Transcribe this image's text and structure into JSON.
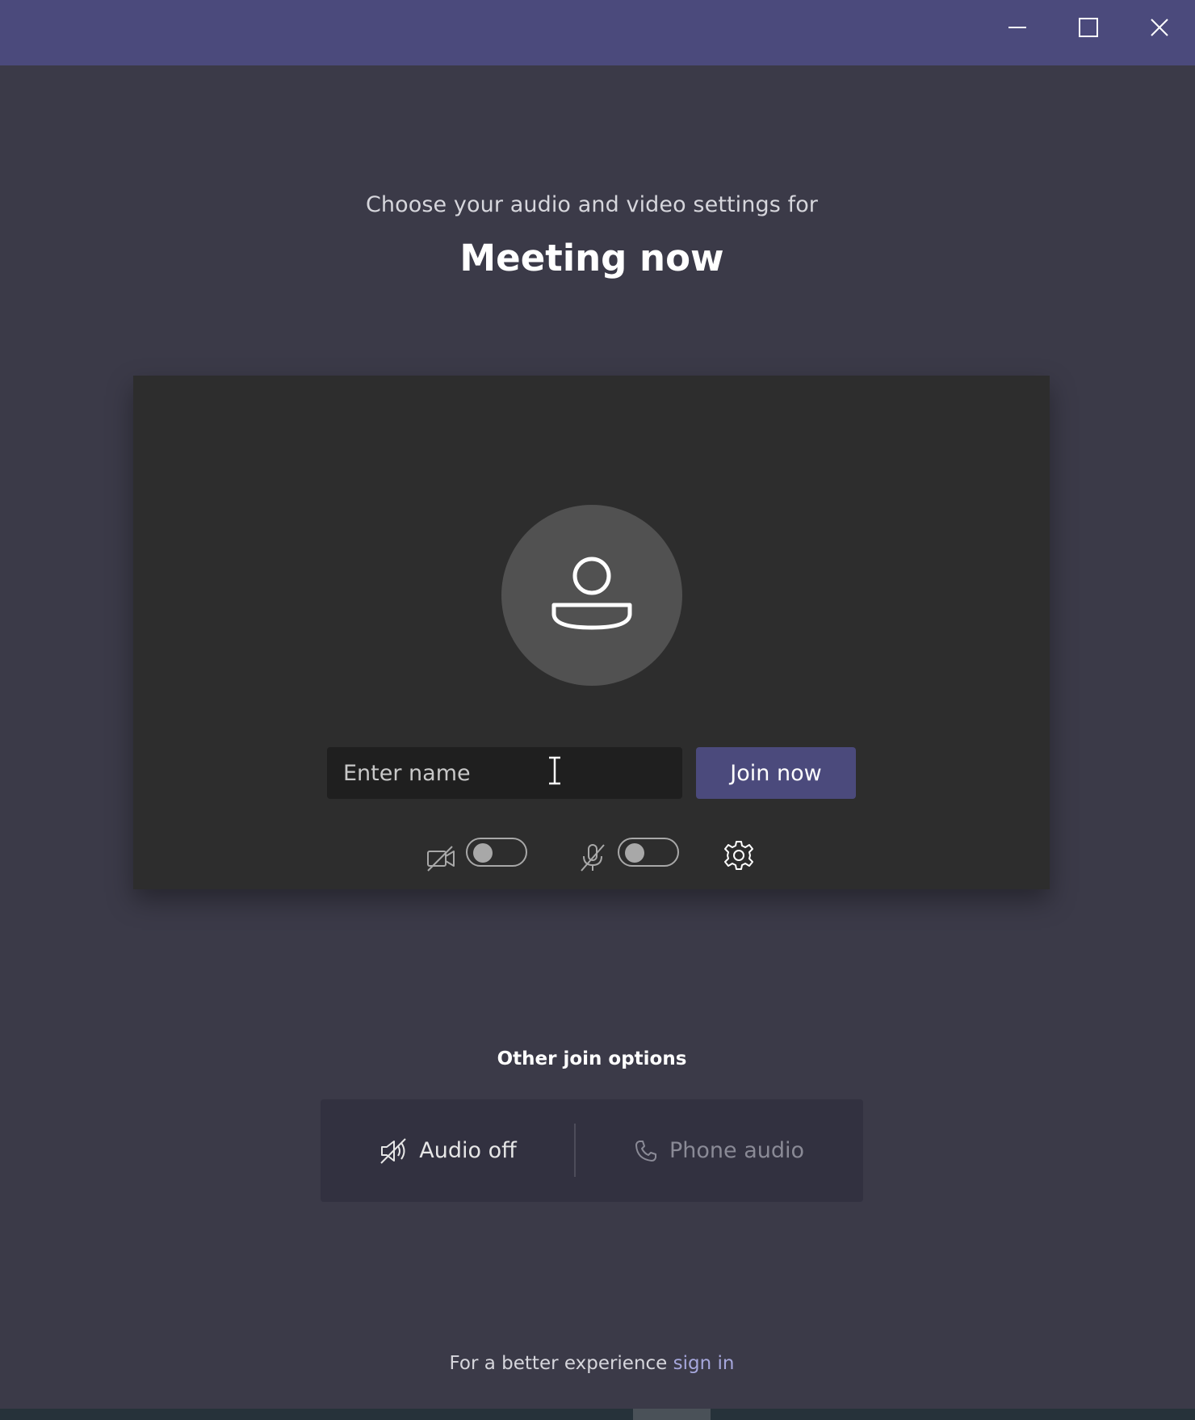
{
  "window": {
    "controls": [
      "minimize",
      "maximize",
      "close"
    ],
    "titlebar_color": "#4b4a7c"
  },
  "header": {
    "subtitle": "Choose your audio and video settings for",
    "meeting_title": "Meeting now"
  },
  "preview": {
    "name_placeholder": "Enter name",
    "name_value": "",
    "join_label": "Join now",
    "camera_enabled": false,
    "mic_enabled": false,
    "icons": [
      "camera-off-icon",
      "mic-off-icon",
      "settings-gear-icon"
    ]
  },
  "other_options": {
    "title": "Other join options",
    "audio_off_label": "Audio off",
    "phone_audio_label": "Phone audio"
  },
  "footer": {
    "prefix": "For a better experience",
    "link_label": "sign in"
  },
  "colors": {
    "accent": "#4b4a7c",
    "background": "#3b3a48",
    "card": "#2d2d2d",
    "link": "#a6a7dc"
  }
}
